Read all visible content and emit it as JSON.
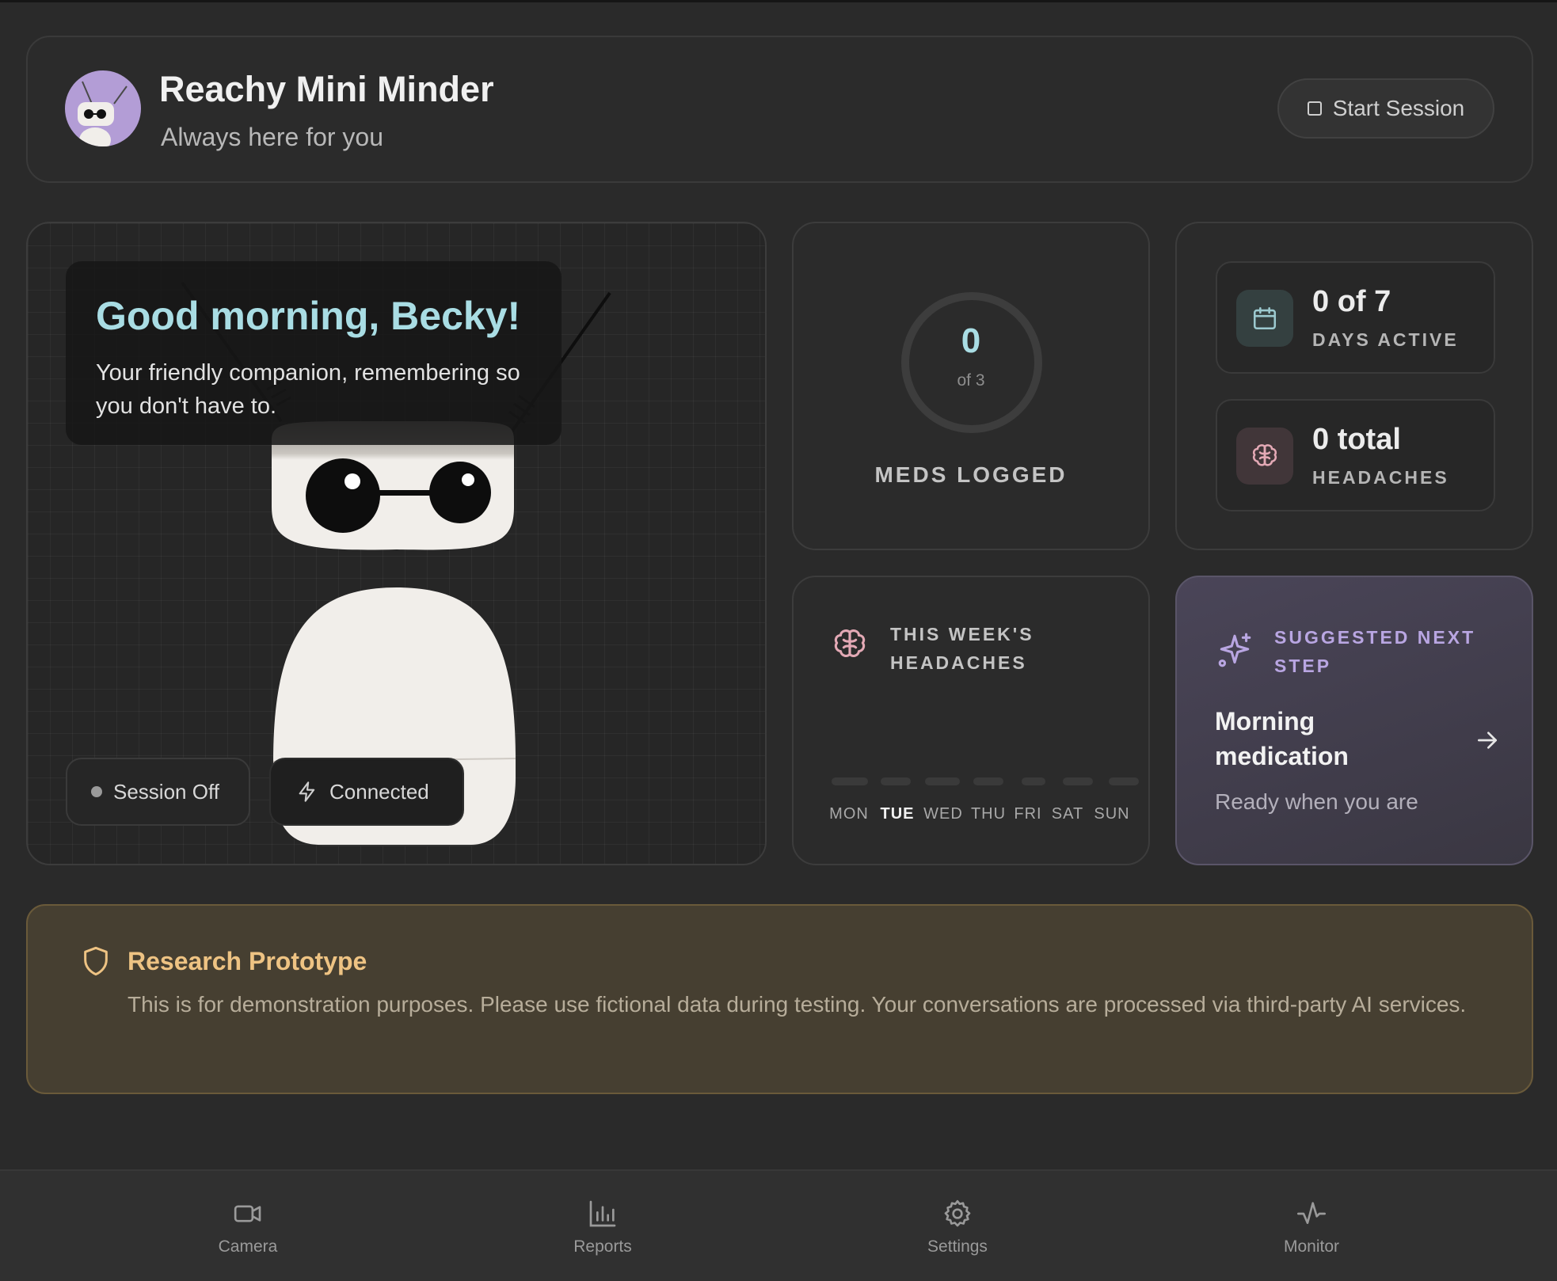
{
  "header": {
    "title": "Reachy Mini Minder",
    "subtitle": "Always here for you",
    "start_session_label": "Start Session"
  },
  "greeting": {
    "title": "Good morning, Becky!",
    "text": "Your friendly companion, remembering so you don't have to."
  },
  "status": {
    "session": "Session Off",
    "connection": "Connected"
  },
  "meds": {
    "value": "0",
    "total": "of 3",
    "label": "MEDS LOGGED",
    "progress_fraction": 0
  },
  "stats": {
    "days_active_value": "0 of 7",
    "days_active_label": "DAYS ACTIVE",
    "headaches_value": "0 total",
    "headaches_label": "HEADACHES"
  },
  "week": {
    "title": "THIS WEEK'S HEADACHES",
    "days": [
      "MON",
      "TUE",
      "WED",
      "THU",
      "FRI",
      "SAT",
      "SUN"
    ],
    "today": "TUE",
    "counts": [
      0,
      0,
      0,
      0,
      0,
      0,
      0
    ]
  },
  "suggestion": {
    "title": "SUGGESTED NEXT STEP",
    "main": "Morning medication",
    "sub": "Ready when you are"
  },
  "notice": {
    "title": "Research Prototype",
    "text": "This is for demonstration purposes. Please use fictional data during testing. Your conversations are processed via third-party AI services."
  },
  "nav": {
    "items": [
      {
        "label": "Camera",
        "icon": "camera-icon"
      },
      {
        "label": "Reports",
        "icon": "bar-chart-icon"
      },
      {
        "label": "Settings",
        "icon": "gear-icon"
      },
      {
        "label": "Monitor",
        "icon": "activity-icon"
      }
    ]
  },
  "colors": {
    "accent_teal": "#a9dde4",
    "accent_purple": "#b9a6e2",
    "warning_gold": "#eec383",
    "background": "#2a2a2a"
  }
}
